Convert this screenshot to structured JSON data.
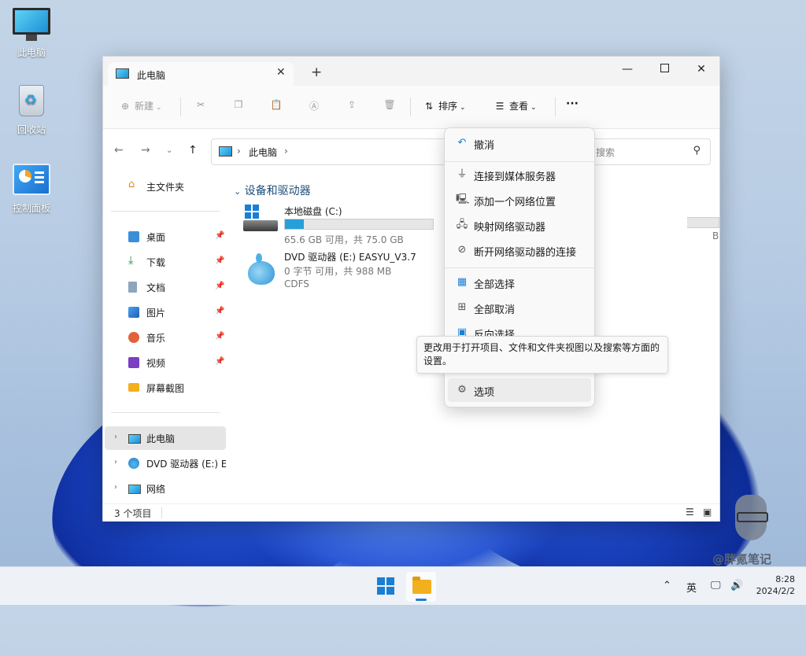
{
  "desktop": {
    "icons": [
      {
        "label": "此电脑"
      },
      {
        "label": "回收站"
      },
      {
        "label": "控制面板"
      }
    ]
  },
  "window": {
    "tab_title": "此电脑",
    "toolbar": {
      "new_label": "新建",
      "sort_label": "排序",
      "view_label": "查看",
      "more_label": "···"
    },
    "address": {
      "location": "此电脑",
      "search_placeholder": "中搜索"
    },
    "sidebar": {
      "home": "主文件夹",
      "quick": [
        {
          "label": "桌面",
          "icon": "desktop-icon"
        },
        {
          "label": "下载",
          "icon": "download-icon"
        },
        {
          "label": "文档",
          "icon": "document-icon"
        },
        {
          "label": "图片",
          "icon": "picture-icon"
        },
        {
          "label": "音乐",
          "icon": "music-icon"
        },
        {
          "label": "视频",
          "icon": "video-icon"
        },
        {
          "label": "屏幕截图",
          "icon": "folder-icon"
        }
      ],
      "tree": [
        {
          "label": "此电脑"
        },
        {
          "label": "DVD 驱动器 (E:) EA"
        },
        {
          "label": "网络"
        }
      ]
    },
    "content": {
      "group_title": "设备和驱动器",
      "drives": [
        {
          "name": "本地磁盘 (C:)",
          "usage": "65.6 GB 可用，共 75.0 GB",
          "used_fraction": 0.125
        },
        {
          "name": "DVD 驱动器 (E:) EASYU_V3.7",
          "usage": "0 字节 可用，共 988 MB",
          "fs": "CDFS"
        }
      ],
      "hidden_partial": "B"
    },
    "status": {
      "item_count": "3 个项目"
    }
  },
  "menu": {
    "items": [
      {
        "label": "撤消",
        "icon": "undo-icon"
      },
      {
        "label": "连接到媒体服务器",
        "icon": "media-server-icon"
      },
      {
        "label": "添加一个网络位置",
        "icon": "network-location-icon"
      },
      {
        "label": "映射网络驱动器",
        "icon": "map-drive-icon"
      },
      {
        "label": "断开网络驱动器的连接",
        "icon": "disconnect-drive-icon"
      },
      {
        "label": "全部选择",
        "icon": "select-all-icon"
      },
      {
        "label": "全部取消",
        "icon": "select-none-icon"
      },
      {
        "label": "反向选择",
        "icon": "invert-selection-icon"
      },
      {
        "label": "选项",
        "icon": "gear-icon"
      }
    ]
  },
  "tooltip": {
    "text": "更改用于打开项目、文件和文件夹视图以及搜索等方面的设置。"
  },
  "taskbar": {
    "ime": "英",
    "time": "8:28",
    "date": "2024/2/2"
  },
  "watermark": {
    "text": "@胖氪笔记"
  }
}
